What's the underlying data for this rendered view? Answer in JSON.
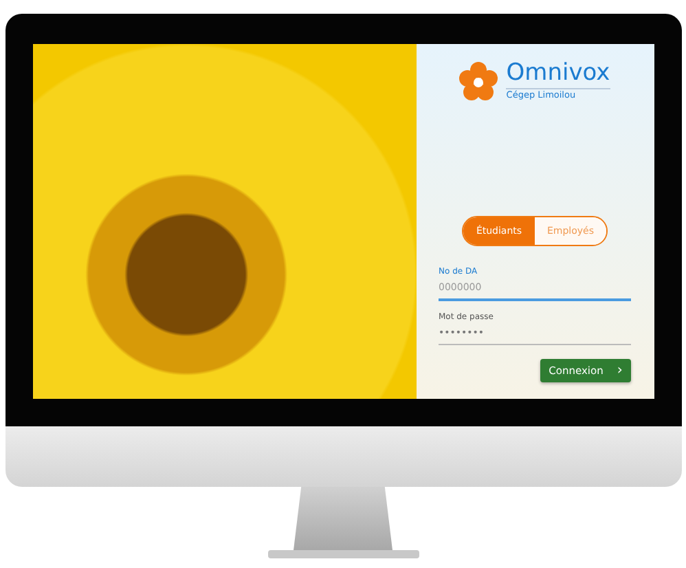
{
  "logo": {
    "name": "Omnivox",
    "subtitle": "Cégep Limoilou"
  },
  "tabs": [
    {
      "label": "Étudiants",
      "selected": true
    },
    {
      "label": "Employés",
      "selected": false
    }
  ],
  "fields": [
    {
      "label": "No de DA",
      "placeholder": "0000000",
      "focused": true
    },
    {
      "label": "Mot de passe",
      "value": "••••••••",
      "focused": false
    }
  ],
  "buttons": [
    {
      "label": "Connexion",
      "icon": "›"
    }
  ]
}
